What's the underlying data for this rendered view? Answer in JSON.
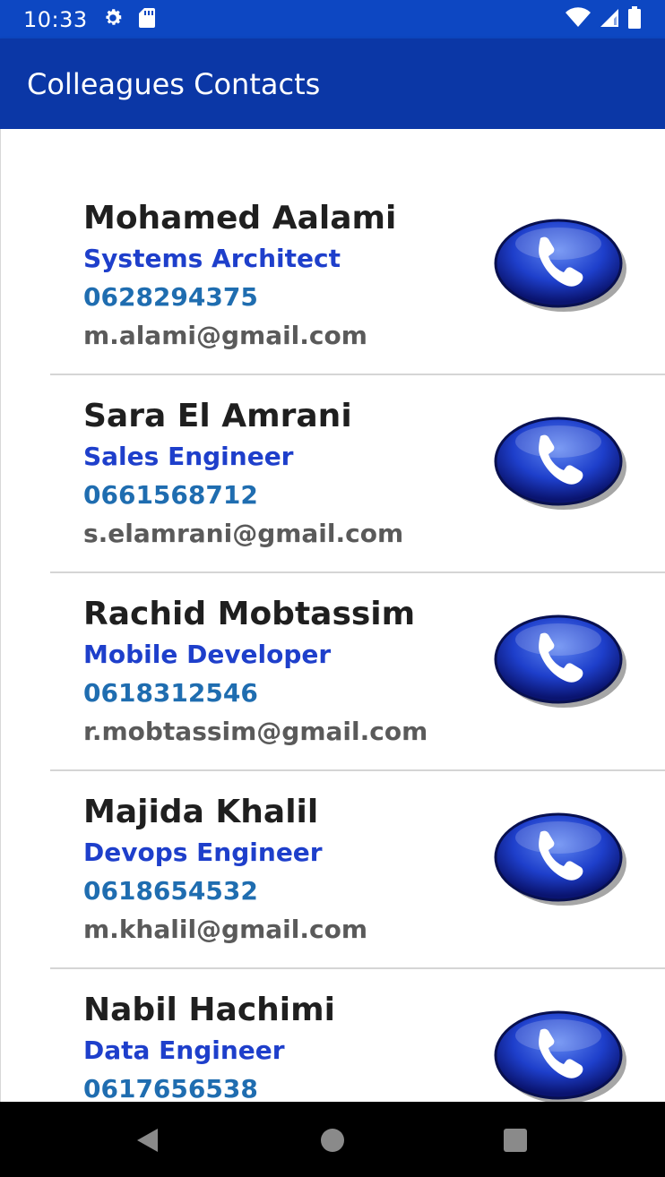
{
  "status_bar": {
    "time": "10:33",
    "icons": [
      "gear-icon",
      "sd-card-icon",
      "wifi-icon",
      "signal-icon",
      "battery-icon"
    ]
  },
  "app_bar": {
    "title": "Colleagues Contacts",
    "color": "#0B37A6"
  },
  "contacts": [
    {
      "name": "Mohamed Aalami",
      "title": "Systems Architect",
      "phone": "0628294375",
      "email": "m.alami@gmail.com"
    },
    {
      "name": "Sara El Amrani",
      "title": "Sales Engineer",
      "phone": "0661568712",
      "email": "s.elamrani@gmail.com"
    },
    {
      "name": "Rachid Mobtassim",
      "title": "Mobile Developer",
      "phone": "0618312546",
      "email": "r.mobtassim@gmail.com"
    },
    {
      "name": "Majida Khalil",
      "title": "Devops Engineer",
      "phone": "0618654532",
      "email": "m.khalil@gmail.com"
    },
    {
      "name": "Nabil Hachimi",
      "title": "Data Engineer",
      "phone": "0617656538",
      "email": ""
    }
  ],
  "colors": {
    "name": "#1f1f1f",
    "title": "#1E3FCB",
    "phone": "#1F6DB0",
    "email": "#5a5a5a"
  },
  "nav_bar": {
    "icons": [
      "back-icon",
      "home-icon",
      "recents-icon"
    ]
  }
}
